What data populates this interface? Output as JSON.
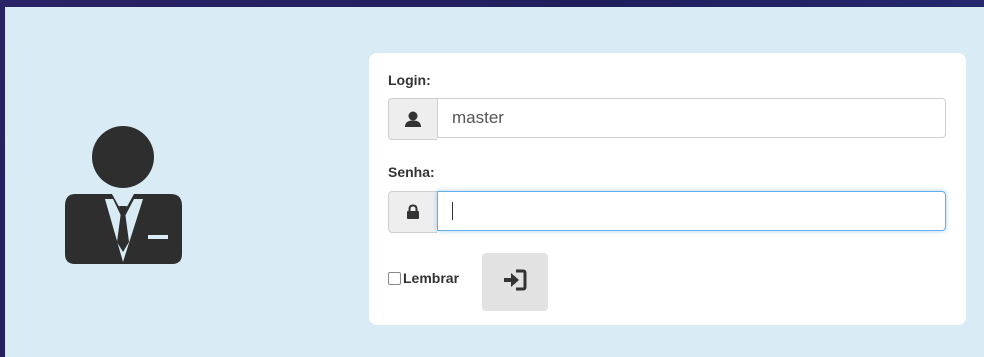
{
  "login_form": {
    "login_label": "Login:",
    "login_value": "master",
    "password_label": "Senha:",
    "password_value": "",
    "remember_label": "Lembrar",
    "remember_checked": false,
    "submit_icon": "sign-in-icon",
    "user_field_icon": "user-icon",
    "password_field_icon": "lock-icon"
  },
  "avatar_icon": "businessman-icon",
  "colors": {
    "panel_bg": "#d9ecf5",
    "card_bg": "#ffffff",
    "focus_border": "#66afe9",
    "icon_dark": "#2e2e2e"
  }
}
